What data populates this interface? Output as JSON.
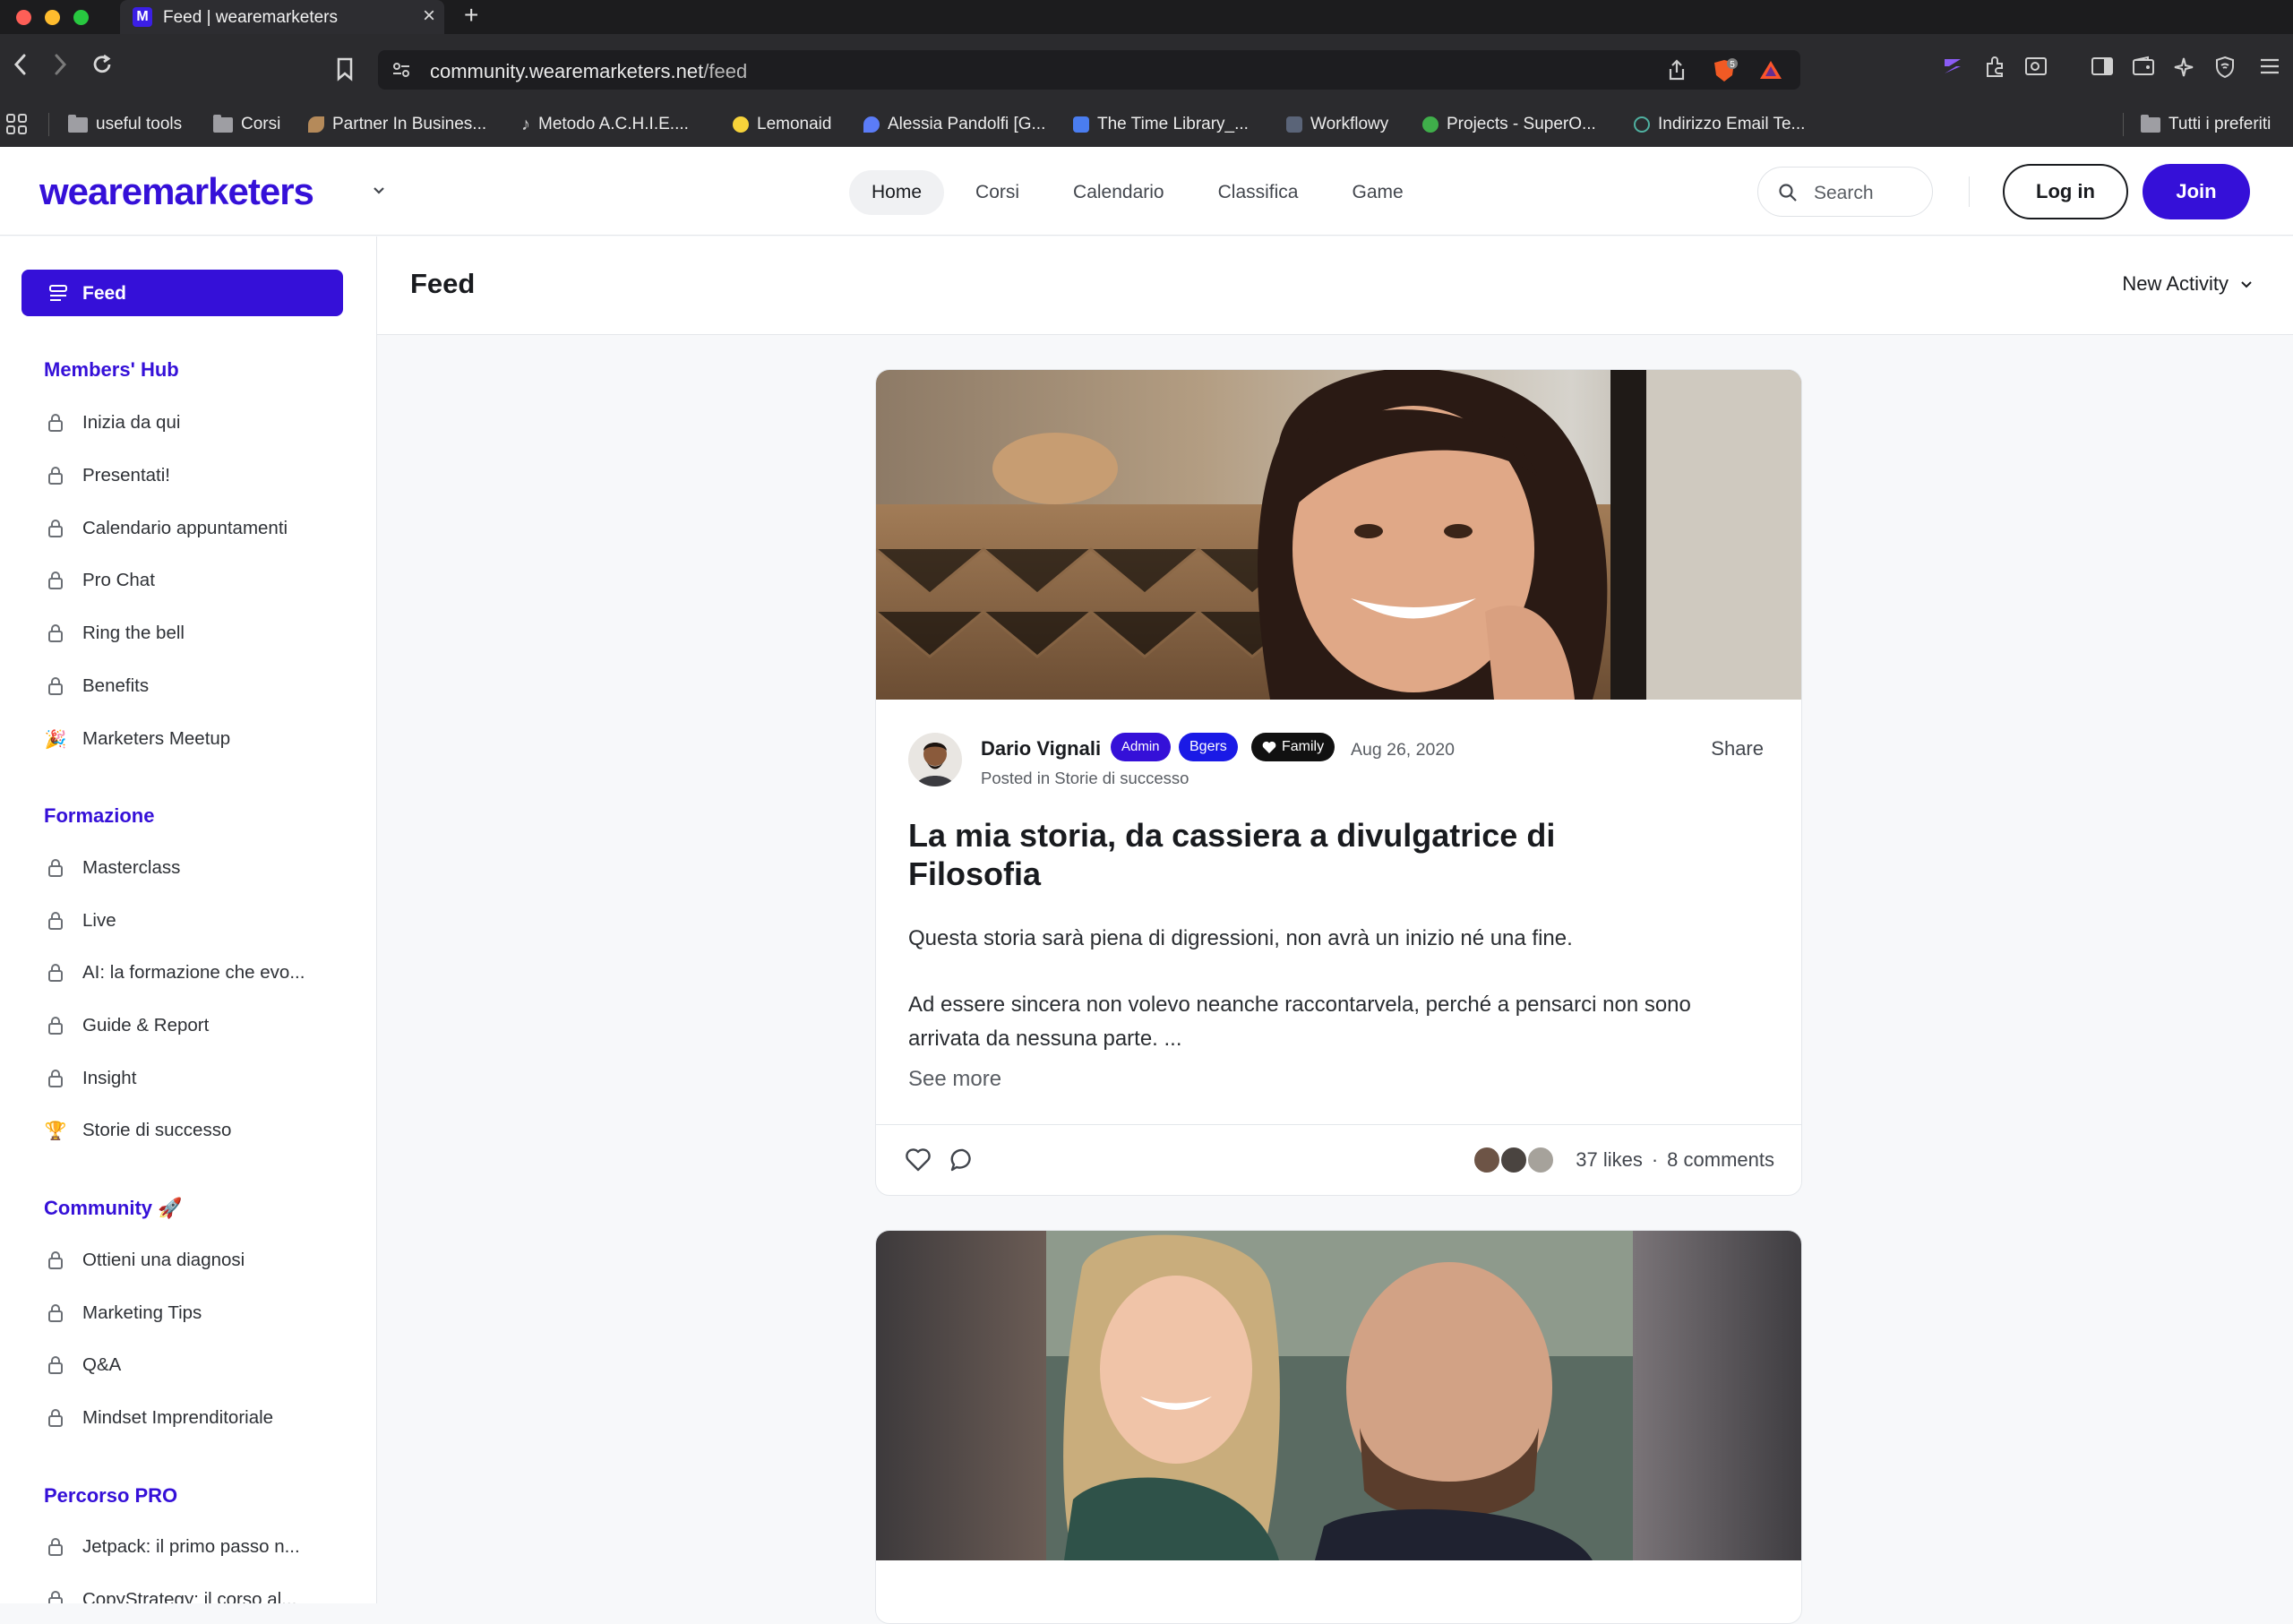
{
  "browser": {
    "tab_title": "Feed | wearemarketers",
    "tab_favicon_letter": "M",
    "url_domain": "community.wearemarketers.net",
    "url_path": "/feed",
    "bookmarks": [
      {
        "label": "useful tools",
        "icon": "folder-icon"
      },
      {
        "label": "Corsi",
        "icon": "folder-icon"
      },
      {
        "label": "Partner In Busines...",
        "icon": "feather-icon"
      },
      {
        "label": "Metodo A.C.H.I.E....",
        "icon": "music-note-icon"
      },
      {
        "label": "Lemonaid",
        "icon": "lemon-icon"
      },
      {
        "label": "Alessia Pandolfi [G...",
        "icon": "droplet-icon"
      },
      {
        "label": "The Time Library_...",
        "icon": "doc-icon"
      },
      {
        "label": "Workflowy",
        "icon": "workflowy-icon"
      },
      {
        "label": "Projects - SuperO...",
        "icon": "superorganizer-icon"
      },
      {
        "label": "Indirizzo Email Te...",
        "icon": "globe-icon"
      }
    ],
    "bookmarks_all": "Tutti i preferiti",
    "shield_count": "5"
  },
  "header": {
    "logo": "wearemarketers",
    "nav": [
      "Home",
      "Corsi",
      "Calendario",
      "Classifica",
      "Game"
    ],
    "active_nav": "Home",
    "search_placeholder": "Search",
    "login_label": "Log in",
    "join_label": "Join",
    "brand_color": "#3510d8"
  },
  "sidebar": {
    "feed_label": "Feed",
    "sections": [
      {
        "title": "Members' Hub",
        "items": [
          {
            "label": "Inizia da qui",
            "icon": "lock-icon"
          },
          {
            "label": "Presentati!",
            "icon": "lock-icon"
          },
          {
            "label": "Calendario appuntamenti",
            "icon": "lock-icon"
          },
          {
            "label": "Pro Chat",
            "icon": "lock-icon"
          },
          {
            "label": "Ring the bell",
            "icon": "lock-icon"
          },
          {
            "label": "Benefits",
            "icon": "lock-icon"
          },
          {
            "label": "Marketers Meetup",
            "icon": "party-popper-icon"
          }
        ]
      },
      {
        "title": "Formazione",
        "items": [
          {
            "label": "Masterclass",
            "icon": "lock-icon"
          },
          {
            "label": "Live",
            "icon": "lock-icon"
          },
          {
            "label": "AI: la formazione che evo...",
            "icon": "lock-icon"
          },
          {
            "label": "Guide & Report",
            "icon": "lock-icon"
          },
          {
            "label": "Insight",
            "icon": "lock-icon"
          },
          {
            "label": "Storie di successo",
            "icon": "trophy-icon"
          }
        ]
      },
      {
        "title": "Community 🚀",
        "items": [
          {
            "label": "Ottieni una diagnosi",
            "icon": "lock-icon"
          },
          {
            "label": "Marketing Tips",
            "icon": "lock-icon"
          },
          {
            "label": "Q&A",
            "icon": "lock-icon"
          },
          {
            "label": "Mindset Imprenditoriale",
            "icon": "lock-icon"
          }
        ]
      },
      {
        "title": "Percorso PRO",
        "items": [
          {
            "label": "Jetpack: il primo passo n...",
            "icon": "lock-icon"
          },
          {
            "label": "CopyStrategy: il corso al...",
            "icon": "lock-icon"
          }
        ]
      }
    ]
  },
  "feed": {
    "title": "Feed",
    "sort_label": "New Activity"
  },
  "posts": [
    {
      "author": "Dario Vignali",
      "badges": [
        {
          "label": "Admin",
          "color": "#3510d8"
        },
        {
          "label": "Bgers",
          "color": "#1a1ae6"
        },
        {
          "label": "Family",
          "color": "#111111",
          "icon": "heart-icon"
        }
      ],
      "date": "Aug 26, 2020",
      "posted_in": "Posted in Storie di successo",
      "share_label": "Share",
      "title": "La mia storia, da cassiera a divulgatrice di Filosofia",
      "body": [
        "Questa storia sarà piena di digressioni, non avrà un inizio né una fine.",
        "Ad essere sincera non volevo neanche raccontarvela, perché a pensarci non sono arrivata da nessuna parte. ..."
      ],
      "see_more": "See more",
      "likes_label": "37 likes",
      "separator": "·",
      "comments_label": "8 comments"
    }
  ]
}
